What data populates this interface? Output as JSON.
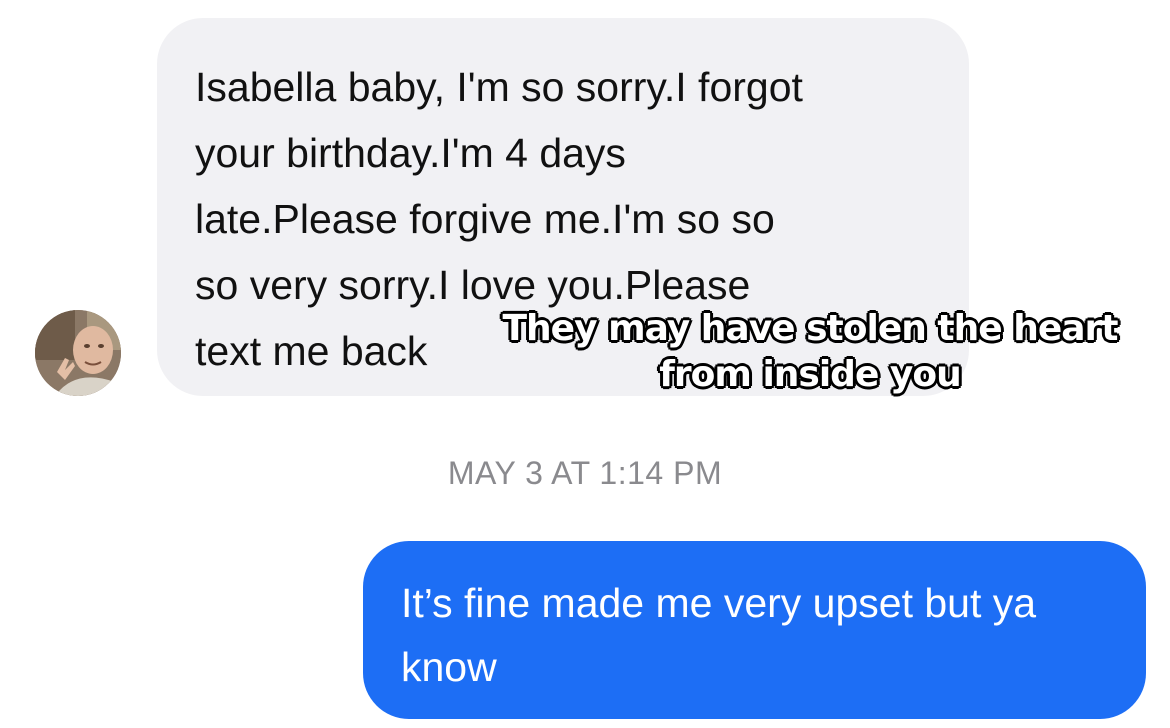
{
  "conversation": {
    "incoming_message": {
      "text": "Isabella baby, I'm so sorry.I forgot\nyour birthday.I'm 4 days\nlate.Please forgive me.I'm so so\nso very sorry.I love you.Please\ntext me back",
      "bubble_color": "#f1f1f4",
      "avatar_icon": "user-photo-icon"
    },
    "overlay_caption": "They may have stolen the heart from inside you",
    "timestamp": "MAY 3 AT 1:14 PM",
    "outgoing_message": {
      "text": "It’s fine made me very upset but ya know",
      "bubble_color": "#1d6ef5"
    }
  }
}
